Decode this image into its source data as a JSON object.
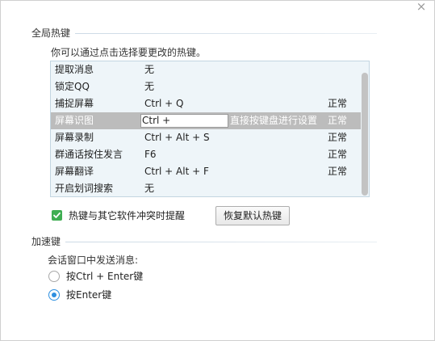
{
  "window": {
    "close_icon": "close-icon",
    "close_glyph": "×"
  },
  "global_hotkeys": {
    "section_title": "全局热键",
    "instruction": "你可以通过点击选择要更改的热键。",
    "rows": [
      {
        "name": "提取消息",
        "key": "无",
        "status": ""
      },
      {
        "name": "锁定QQ",
        "key": "无",
        "status": ""
      },
      {
        "name": "捕捉屏幕",
        "key": "Ctrl + Q",
        "status": "正常"
      },
      {
        "name": "屏幕识图",
        "key": "Ctrl + ",
        "status": "正常",
        "hint": "直接按键盘进行设置"
      },
      {
        "name": "屏幕录制",
        "key": "Ctrl + Alt + S",
        "status": "正常"
      },
      {
        "name": "群通话按住发言",
        "key": "F6",
        "status": "正常"
      },
      {
        "name": "屏幕翻译",
        "key": "Ctrl + Alt + F",
        "status": "正常"
      },
      {
        "name": "开启划词搜索",
        "key": "无",
        "status": ""
      }
    ],
    "selected_row": 3,
    "conflict_checkbox": {
      "label": "热键与其它软件冲突时提醒",
      "checked": true
    },
    "restore_button": "恢复默认热键"
  },
  "accelerator": {
    "section_title": "加速键",
    "send_label": "会话窗口中发送消息:",
    "options": [
      {
        "label": "按Ctrl + Enter键",
        "checked": false
      },
      {
        "label": "按Enter键",
        "checked": true
      }
    ]
  },
  "colors": {
    "accent": "#2d8fe0",
    "check_green": "#3fae52",
    "list_background": "#eef5f9",
    "selected_row": "#bcbcbc"
  }
}
